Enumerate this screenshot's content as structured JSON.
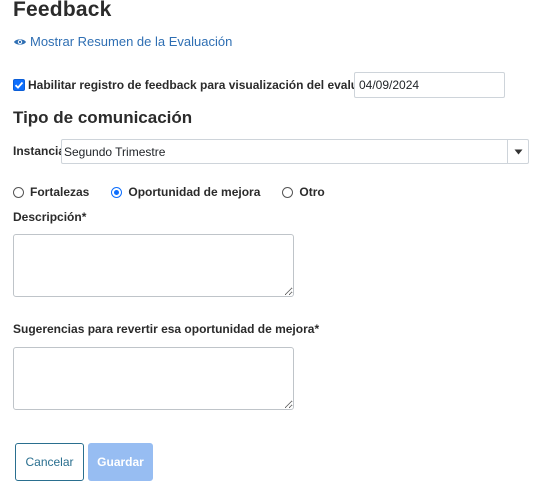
{
  "page": {
    "title": "Feedback"
  },
  "summary_link": {
    "label": "Mostrar Resumen de la Evaluación",
    "icon": "eye-icon"
  },
  "feedback_toggle": {
    "label": "Habilitar registro de feedback para visualización del evaluado.",
    "checked": true,
    "date_value": "04/09/2024"
  },
  "communication": {
    "title": "Tipo de comunicación",
    "instancia_label": "Instancia",
    "instancia_value": "Segundo Trimestre"
  },
  "type_options": [
    {
      "label": "Fortalezas",
      "selected": false
    },
    {
      "label": "Oportunidad de mejora",
      "selected": true
    },
    {
      "label": "Otro",
      "selected": false
    }
  ],
  "fields": {
    "descripcion_label": "Descripción*",
    "sugerencias_label": "Sugerencias para revertir esa oportunidad de mejora*"
  },
  "buttons": {
    "cancel": "Cancelar",
    "save": "Guardar"
  },
  "colors": {
    "accent": "#0d6efd",
    "link": "#2f6fb3",
    "save_disabled": "#97bdf2",
    "cancel_border": "#2a6f8f"
  }
}
